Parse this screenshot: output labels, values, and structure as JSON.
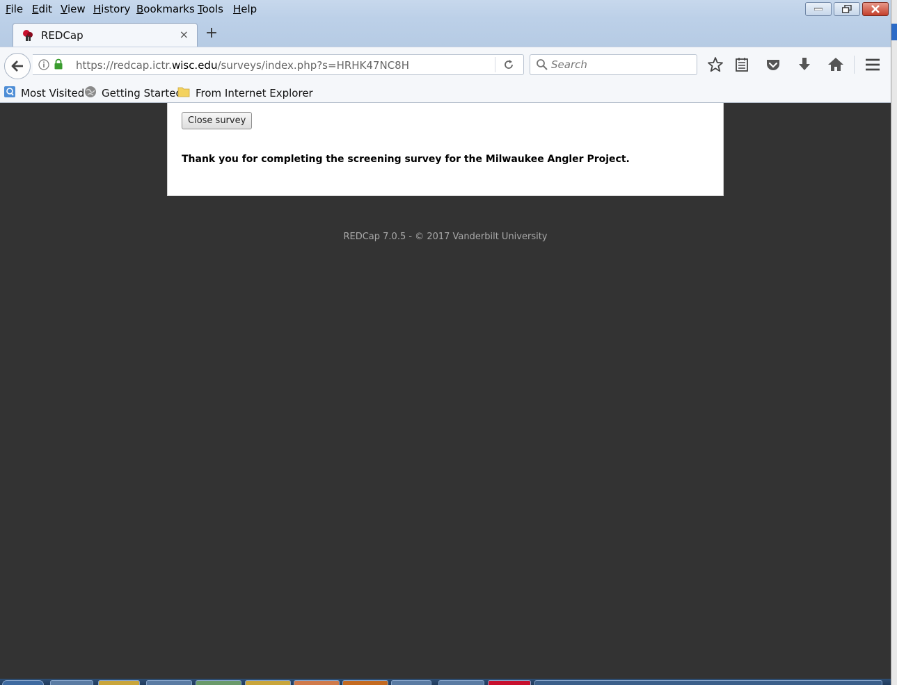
{
  "menubar": {
    "items": [
      {
        "label": "File"
      },
      {
        "label": "Edit"
      },
      {
        "label": "View"
      },
      {
        "label": "History"
      },
      {
        "label": "Bookmarks"
      },
      {
        "label": "Tools"
      },
      {
        "label": "Help"
      }
    ]
  },
  "tab": {
    "title": "REDCap",
    "close_label": "×",
    "new_tab_label": "+"
  },
  "urlbar": {
    "prefix": "https://redcap.ictr.",
    "domain": "wisc.edu",
    "path": "/surveys/index.php?s=HRHK47NC8H"
  },
  "search": {
    "placeholder": "Search"
  },
  "bookmarks": [
    {
      "label": "Most Visited"
    },
    {
      "label": "Getting Started"
    },
    {
      "label": "From Internet Explorer"
    }
  ],
  "page": {
    "close_button": "Close survey",
    "message": "Thank you for completing the screening survey for the Milwaukee Angler Project.",
    "footer": "REDCap 7.0.5 - © 2017 Vanderbilt University"
  },
  "colors": {
    "page_background": "#333333",
    "panel_background": "#ffffff"
  }
}
